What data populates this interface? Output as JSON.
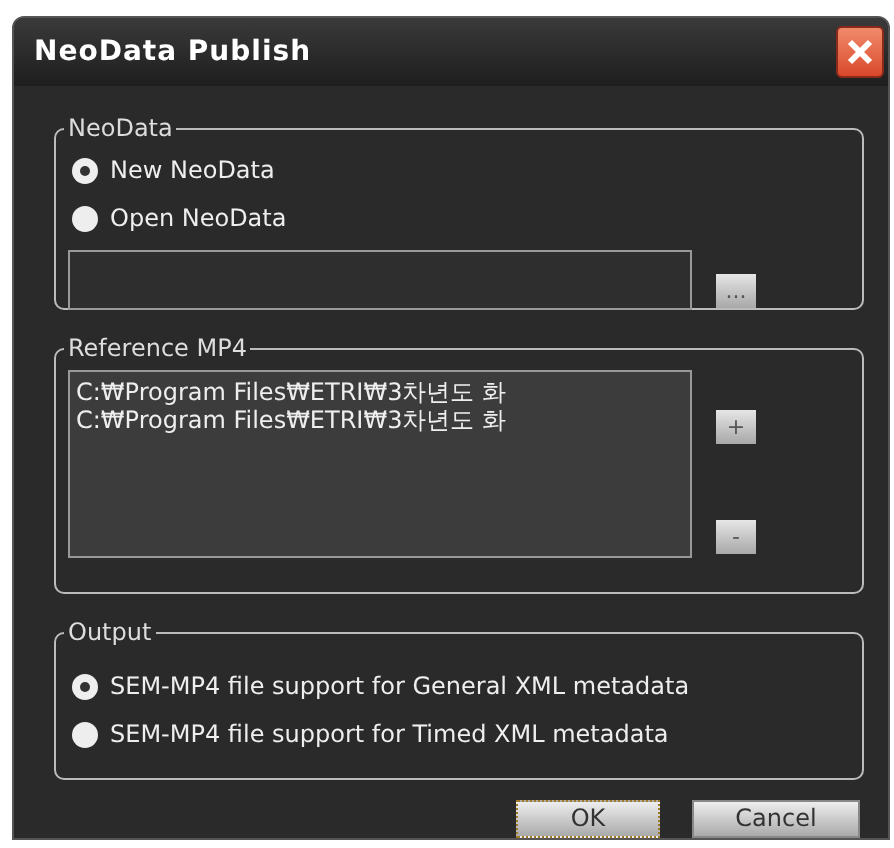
{
  "window": {
    "title": "NeoData Publish"
  },
  "neodata": {
    "label": "NeoData",
    "options": [
      {
        "label": "New NeoData",
        "selected": true
      },
      {
        "label": "Open NeoData",
        "selected": false
      }
    ],
    "browse_button": "..."
  },
  "reference": {
    "label": "Reference MP4",
    "files": [
      "C:₩Program Files₩ETRI₩3차년도 화",
      "C:₩Program Files₩ETRI₩3차년도 화"
    ],
    "add_button": "+",
    "remove_button": "-"
  },
  "output": {
    "label": "Output",
    "options": [
      {
        "label": "SEM-MP4 file support for General XML metadata",
        "selected": true
      },
      {
        "label": "SEM-MP4 file support for Timed XML metadata",
        "selected": false
      }
    ]
  },
  "buttons": [
    {
      "label": "OK",
      "focused": true
    },
    {
      "label": "Cancel",
      "focused": false
    }
  ]
}
